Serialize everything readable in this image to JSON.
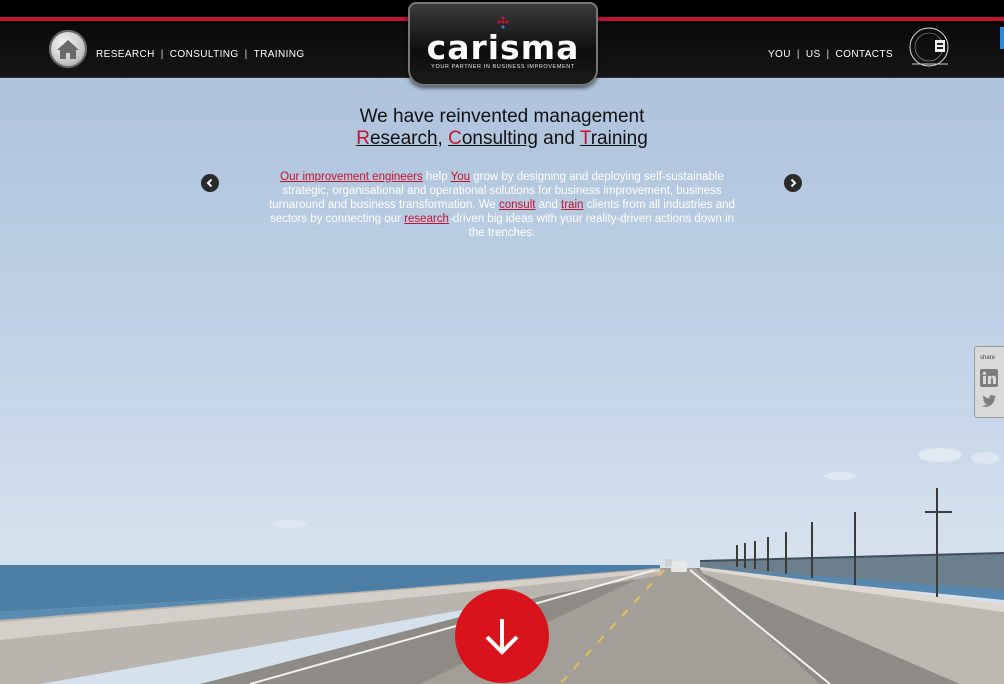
{
  "header": {
    "nav_left": [
      "RESEARCH",
      "CONSULTING",
      "TRAINING"
    ],
    "nav_right": [
      "YOU",
      "US",
      "CONTACTS"
    ],
    "logo": {
      "name": "carisma",
      "tagline": "YOUR PARTNER IN BUSINESS IMPROVEMENT"
    }
  },
  "hero": {
    "headline_line1": "We have reinvented management",
    "headline_line2": {
      "w1_first": "R",
      "w1_rest": "esearch",
      "sep1": ", ",
      "w2_first": "C",
      "w2_rest": "onsulting",
      "sep2": " and ",
      "w3_first": "T",
      "w3_rest": "raining"
    },
    "paragraph": {
      "link1": "Our improvement engineers",
      "t1": " help ",
      "link2": "You",
      "t2": " grow by designing and deploying self-sustainable strategic, organisational and operational solutions for business improvement, business turnaround and business transformation. We ",
      "link3": "consult",
      "t3": " and ",
      "link4": "train",
      "t4": " clients from all industries and sectors by connecting our ",
      "link5": "research",
      "t5": "-driven big ideas with your reality-driven actions down in the trenches."
    }
  },
  "share": {
    "label": "share",
    "icons": [
      "linkedin-icon",
      "twitter-icon"
    ]
  },
  "colors": {
    "accent": "#c41230",
    "down_button": "#d9131b",
    "header": "#000000"
  }
}
